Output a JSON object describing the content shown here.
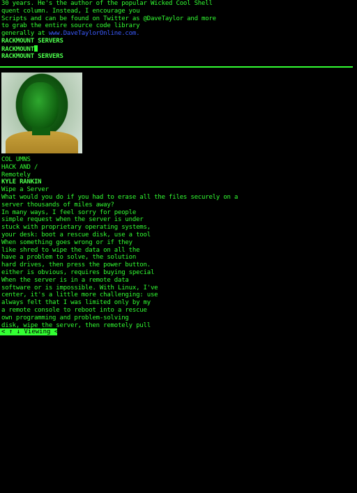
{
  "upper_lines": [
    "30 years. He's the author of the popular Wicked Cool Shell",
    "quent column. Instead, I encourage you",
    "Scripts and can be found on Twitter as @DaveTaylor and more",
    "to grab the entire source code library"
  ],
  "link_line": {
    "prefix": "generally at ",
    "link_text": "www.DaveTaylorOnline.com."
  },
  "heading_lines": [
    "RACKMOUNT SERVERS",
    "RACKMOUNT"
  ],
  "heading_line_after_cursor": "RACKMOUNT SERVERS",
  "photo": {
    "description_icon": "author-photo"
  },
  "column_lines": [
    "COL UMNS",
    "HACK AND /",
    "Remotely"
  ],
  "author": "KYLE RANKIN",
  "article_lines": [
    "Wipe a Server",
    "What would you do if you had to erase all the files securely on a",
    "server thousands of miles away?",
    "In many ways, I feel sorry for people",
    "simple request when the server is under",
    "stuck with proprietary operating systems,",
    "your desk: boot a rescue disk, use a tool",
    "When something goes wrong or if they",
    "like shred to wipe the data on all the",
    "have a problem to solve, the solution",
    "hard drives, then press the power button.",
    "either is obvious, requires buying special",
    "When the server is in a remote data",
    "software or is impossible. With Linux, I've",
    "center, it's a little more challenging: use",
    "always felt that I was limited only by my",
    "a remote console to reboot into a rescue",
    "own programming and problem-solving",
    "disk, wipe the server, then remotely pull"
  ],
  "status": "< ↑ ↓ Viewing <>",
  "colors": {
    "foreground": "#33ff33",
    "background": "#000000",
    "link": "#3b5bff"
  }
}
